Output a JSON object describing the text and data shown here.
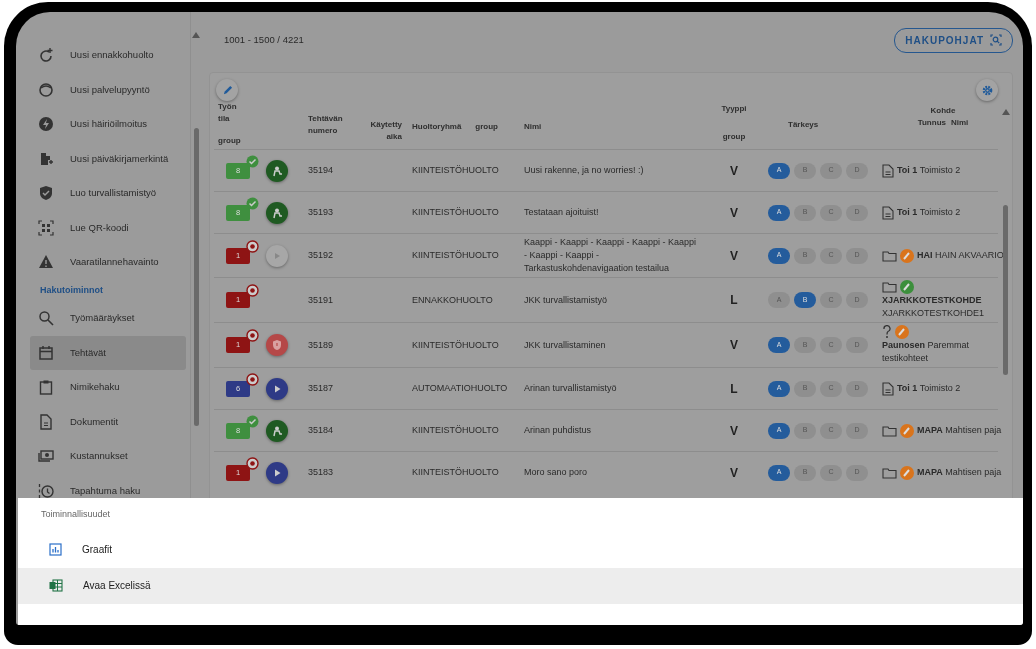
{
  "sidebar": {
    "actions": [
      {
        "label": "Uusi ennakkohuolto"
      },
      {
        "label": "Uusi palvelupyyntö"
      },
      {
        "label": "Uusi häiriöilmoitus"
      },
      {
        "label": "Uusi päiväkirjamerkintä"
      },
      {
        "label": "Luo turvallistamistyö"
      },
      {
        "label": "Lue QR-koodi"
      },
      {
        "label": "Vaaratilannehavainto"
      }
    ],
    "section_title": "Hakutoiminnot",
    "search_items": [
      {
        "label": "Työmääräykset",
        "selected": false
      },
      {
        "label": "Tehtävät",
        "selected": true
      },
      {
        "label": "Nimikehaku",
        "selected": false
      },
      {
        "label": "Dokumentit",
        "selected": false
      },
      {
        "label": "Kustannukset",
        "selected": false
      },
      {
        "label": "Tapahtuma haku",
        "selected": false
      }
    ]
  },
  "range": "1001 - 1500 / 4221",
  "templates_button": "HAKUPOHJAT",
  "table": {
    "columns": [
      {
        "lines": [
          "Työn",
          "tila",
          "group"
        ]
      },
      {},
      {
        "lines": [
          "Tehtävän",
          "numero"
        ]
      },
      {
        "lines": [
          "Käytetty",
          "aika"
        ]
      },
      {
        "lines": [
          "Huoltoryhmä",
          "group"
        ]
      },
      {
        "lines": [
          "Nimi"
        ]
      },
      {
        "lines": [
          "Tyyppi",
          "group"
        ]
      },
      {
        "lines": [
          "Tärkeys"
        ]
      },
      {
        "lines": [
          "Kohde",
          "Tunnus",
          "Nimi"
        ]
      }
    ],
    "rows": [
      {
        "status": {
          "count": "8",
          "color": "#3f8f3f",
          "kind": "check"
        },
        "action": {
          "kind": "person"
        },
        "number": "35194",
        "group": "KIINTEISTÖHUOLTO",
        "name": "Uusi rakenne, ja no worries! :)",
        "type": "V",
        "priority": [
          {
            "label": "A",
            "selected": true
          },
          {
            "label": "B",
            "selected": false
          },
          {
            "label": "C",
            "selected": false
          },
          {
            "label": "D",
            "selected": false
          }
        ],
        "target": {
          "kind": "document",
          "text": "**Toi 1** Toimisto 2"
        }
      },
      {
        "status": {
          "count": "8",
          "color": "#3f8f3f",
          "kind": "check"
        },
        "action": {
          "kind": "person"
        },
        "number": "35193",
        "group": "KIINTEISTÖHUOLTO",
        "name": "Testataan ajoituist!",
        "type": "V",
        "priority": [
          {
            "label": "A",
            "selected": true
          },
          {
            "label": "B",
            "selected": false
          },
          {
            "label": "C",
            "selected": false
          },
          {
            "label": "D",
            "selected": false
          }
        ],
        "target": {
          "kind": "document",
          "text": "**Toi 1** Toimisto 2"
        }
      },
      {
        "status": {
          "count": "1",
          "color": "#8e1414",
          "kind": "target"
        },
        "action": {
          "kind": "play-disabled"
        },
        "number": "35192",
        "group": "KIINTEISTÖHUOLTO",
        "name": "Kaappi - Kaappi - Kaappi - Kaappi - Kaappi - Kaappi - Kaappi - Tarkastuskohdenavigaation testailua",
        "type": "V",
        "priority": [
          {
            "label": "A",
            "selected": true
          },
          {
            "label": "B",
            "selected": false
          },
          {
            "label": "C",
            "selected": false
          },
          {
            "label": "D",
            "selected": false
          }
        ],
        "target": {
          "kind": "folder",
          "badge": {
            "color": "#d9741c"
          },
          "text": "**HAI** HAIN AKVAARIO"
        }
      },
      {
        "status": {
          "count": "1",
          "color": "#8e1414",
          "kind": "target"
        },
        "number": "35191",
        "group": "ENNAKKOHUOLTO",
        "name": "JKK turvallistamistyö",
        "type": "L",
        "priority": [
          {
            "label": "A",
            "selected": false
          },
          {
            "label": "B",
            "selected": true
          },
          {
            "label": "C",
            "selected": false
          },
          {
            "label": "D",
            "selected": false
          }
        ],
        "target": {
          "kind": "folder",
          "badge": {
            "color": "#3c8f3c"
          },
          "text": "**XJARKKOTESTKOHDE** XJARKKOTESTKOHDE1"
        }
      },
      {
        "status": {
          "count": "1",
          "color": "#8e1414",
          "kind": "target"
        },
        "action": {
          "kind": "shield"
        },
        "number": "35189",
        "group": "KIINTEISTÖHUOLTO",
        "name": "JKK turvallistaminen",
        "type": "V",
        "priority": [
          {
            "label": "A",
            "selected": true
          },
          {
            "label": "B",
            "selected": false
          },
          {
            "label": "C",
            "selected": false
          },
          {
            "label": "D",
            "selected": false
          }
        ],
        "target": {
          "kind": "question",
          "badge": {
            "color": "#d9741c"
          },
          "text": "**Paunosen** Paremmat testikohteet"
        }
      },
      {
        "status": {
          "count": "6",
          "color": "#2e3a86",
          "kind": "target"
        },
        "action": {
          "kind": "play"
        },
        "number": "35187",
        "group": "AUTOMAATIOHUOLTO",
        "name": "Arinan turvallistamistyö",
        "type": "L",
        "priority": [
          {
            "label": "A",
            "selected": true
          },
          {
            "label": "B",
            "selected": false
          },
          {
            "label": "C",
            "selected": false
          },
          {
            "label": "D",
            "selected": false
          }
        ],
        "target": {
          "kind": "document",
          "text": "**Toi 1** Toimisto 2"
        }
      },
      {
        "status": {
          "count": "8",
          "color": "#3f8f3f",
          "kind": "check"
        },
        "action": {
          "kind": "person"
        },
        "number": "35184",
        "group": "KIINTEISTÖHUOLTO",
        "name": "Arinan puhdistus",
        "type": "V",
        "priority": [
          {
            "label": "A",
            "selected": true
          },
          {
            "label": "B",
            "selected": false
          },
          {
            "label": "C",
            "selected": false
          },
          {
            "label": "D",
            "selected": false
          }
        ],
        "target": {
          "kind": "folder",
          "badge": {
            "color": "#d9741c"
          },
          "text": "**MAPA** Mahtisen paja"
        }
      },
      {
        "status": {
          "count": "1",
          "color": "#8e1414",
          "kind": "target"
        },
        "action": {
          "kind": "play"
        },
        "number": "35183",
        "group": "KIINTEISTÖHUOLTO",
        "name": "Moro sano poro",
        "type": "V",
        "priority": [
          {
            "label": "A",
            "selected": true
          },
          {
            "label": "B",
            "selected": false
          },
          {
            "label": "C",
            "selected": false
          },
          {
            "label": "D",
            "selected": false
          }
        ],
        "target": {
          "kind": "folder",
          "badge": {
            "color": "#d9741c"
          },
          "text": "**MAPA** Mahtisen paja"
        }
      }
    ]
  },
  "sheet": {
    "title": "Toiminnallisuudet",
    "items": [
      {
        "label": "Graafit",
        "kind": "chart",
        "selected": false
      },
      {
        "label": "Avaa Excelissä",
        "kind": "excel",
        "selected": true
      }
    ]
  }
}
